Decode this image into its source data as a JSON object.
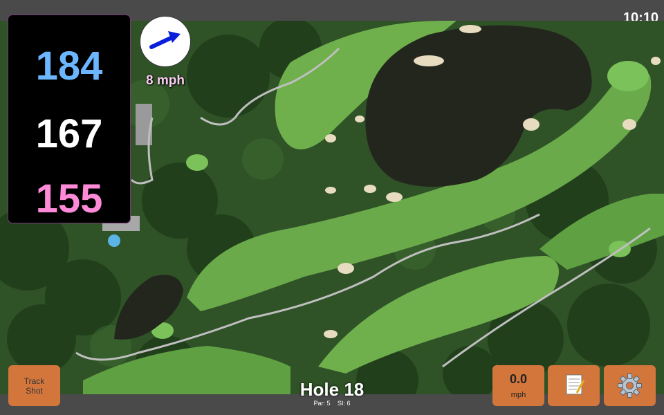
{
  "clock": "10:10",
  "yardages": {
    "back": {
      "value": "184",
      "color": "#6cb6ff"
    },
    "middle": {
      "value": "167",
      "color": "#ffffff"
    },
    "front": {
      "value": "155",
      "color": "#ff8ad8"
    }
  },
  "wind": {
    "speed_label": "8 mph",
    "arrow_icon": "wind-direction-arrow",
    "arrow_color": "#0a1fd8"
  },
  "buttons": {
    "track_shot": {
      "line1": "Track",
      "line2": "Shot"
    },
    "speed": {
      "value": "0.0",
      "unit": "mph"
    },
    "notes_icon": "notepad-icon",
    "settings_icon": "gear-icon",
    "button_color": "#d2763c"
  },
  "hole": {
    "title": "Hole 18",
    "par": "Par: 5",
    "si": "SI: 6"
  }
}
